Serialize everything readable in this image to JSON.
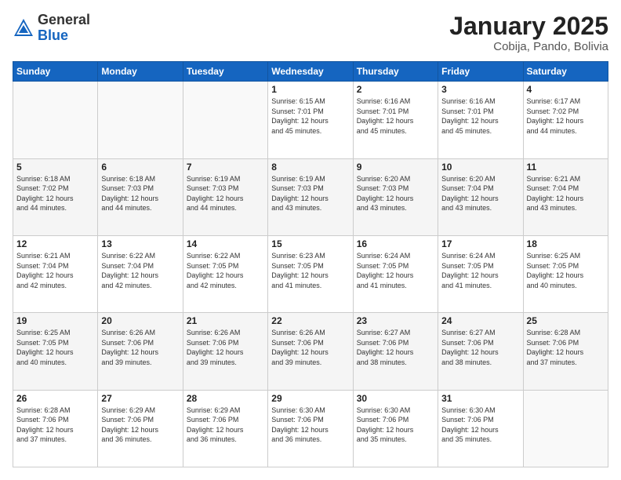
{
  "header": {
    "logo_general": "General",
    "logo_blue": "Blue",
    "month_title": "January 2025",
    "location": "Cobija, Pando, Bolivia"
  },
  "weekdays": [
    "Sunday",
    "Monday",
    "Tuesday",
    "Wednesday",
    "Thursday",
    "Friday",
    "Saturday"
  ],
  "weeks": [
    [
      {
        "day": "",
        "info": ""
      },
      {
        "day": "",
        "info": ""
      },
      {
        "day": "",
        "info": ""
      },
      {
        "day": "1",
        "info": "Sunrise: 6:15 AM\nSunset: 7:01 PM\nDaylight: 12 hours\nand 45 minutes."
      },
      {
        "day": "2",
        "info": "Sunrise: 6:16 AM\nSunset: 7:01 PM\nDaylight: 12 hours\nand 45 minutes."
      },
      {
        "day": "3",
        "info": "Sunrise: 6:16 AM\nSunset: 7:01 PM\nDaylight: 12 hours\nand 45 minutes."
      },
      {
        "day": "4",
        "info": "Sunrise: 6:17 AM\nSunset: 7:02 PM\nDaylight: 12 hours\nand 44 minutes."
      }
    ],
    [
      {
        "day": "5",
        "info": "Sunrise: 6:18 AM\nSunset: 7:02 PM\nDaylight: 12 hours\nand 44 minutes."
      },
      {
        "day": "6",
        "info": "Sunrise: 6:18 AM\nSunset: 7:03 PM\nDaylight: 12 hours\nand 44 minutes."
      },
      {
        "day": "7",
        "info": "Sunrise: 6:19 AM\nSunset: 7:03 PM\nDaylight: 12 hours\nand 44 minutes."
      },
      {
        "day": "8",
        "info": "Sunrise: 6:19 AM\nSunset: 7:03 PM\nDaylight: 12 hours\nand 43 minutes."
      },
      {
        "day": "9",
        "info": "Sunrise: 6:20 AM\nSunset: 7:03 PM\nDaylight: 12 hours\nand 43 minutes."
      },
      {
        "day": "10",
        "info": "Sunrise: 6:20 AM\nSunset: 7:04 PM\nDaylight: 12 hours\nand 43 minutes."
      },
      {
        "day": "11",
        "info": "Sunrise: 6:21 AM\nSunset: 7:04 PM\nDaylight: 12 hours\nand 43 minutes."
      }
    ],
    [
      {
        "day": "12",
        "info": "Sunrise: 6:21 AM\nSunset: 7:04 PM\nDaylight: 12 hours\nand 42 minutes."
      },
      {
        "day": "13",
        "info": "Sunrise: 6:22 AM\nSunset: 7:04 PM\nDaylight: 12 hours\nand 42 minutes."
      },
      {
        "day": "14",
        "info": "Sunrise: 6:22 AM\nSunset: 7:05 PM\nDaylight: 12 hours\nand 42 minutes."
      },
      {
        "day": "15",
        "info": "Sunrise: 6:23 AM\nSunset: 7:05 PM\nDaylight: 12 hours\nand 41 minutes."
      },
      {
        "day": "16",
        "info": "Sunrise: 6:24 AM\nSunset: 7:05 PM\nDaylight: 12 hours\nand 41 minutes."
      },
      {
        "day": "17",
        "info": "Sunrise: 6:24 AM\nSunset: 7:05 PM\nDaylight: 12 hours\nand 41 minutes."
      },
      {
        "day": "18",
        "info": "Sunrise: 6:25 AM\nSunset: 7:05 PM\nDaylight: 12 hours\nand 40 minutes."
      }
    ],
    [
      {
        "day": "19",
        "info": "Sunrise: 6:25 AM\nSunset: 7:05 PM\nDaylight: 12 hours\nand 40 minutes."
      },
      {
        "day": "20",
        "info": "Sunrise: 6:26 AM\nSunset: 7:06 PM\nDaylight: 12 hours\nand 39 minutes."
      },
      {
        "day": "21",
        "info": "Sunrise: 6:26 AM\nSunset: 7:06 PM\nDaylight: 12 hours\nand 39 minutes."
      },
      {
        "day": "22",
        "info": "Sunrise: 6:26 AM\nSunset: 7:06 PM\nDaylight: 12 hours\nand 39 minutes."
      },
      {
        "day": "23",
        "info": "Sunrise: 6:27 AM\nSunset: 7:06 PM\nDaylight: 12 hours\nand 38 minutes."
      },
      {
        "day": "24",
        "info": "Sunrise: 6:27 AM\nSunset: 7:06 PM\nDaylight: 12 hours\nand 38 minutes."
      },
      {
        "day": "25",
        "info": "Sunrise: 6:28 AM\nSunset: 7:06 PM\nDaylight: 12 hours\nand 37 minutes."
      }
    ],
    [
      {
        "day": "26",
        "info": "Sunrise: 6:28 AM\nSunset: 7:06 PM\nDaylight: 12 hours\nand 37 minutes."
      },
      {
        "day": "27",
        "info": "Sunrise: 6:29 AM\nSunset: 7:06 PM\nDaylight: 12 hours\nand 36 minutes."
      },
      {
        "day": "28",
        "info": "Sunrise: 6:29 AM\nSunset: 7:06 PM\nDaylight: 12 hours\nand 36 minutes."
      },
      {
        "day": "29",
        "info": "Sunrise: 6:30 AM\nSunset: 7:06 PM\nDaylight: 12 hours\nand 36 minutes."
      },
      {
        "day": "30",
        "info": "Sunrise: 6:30 AM\nSunset: 7:06 PM\nDaylight: 12 hours\nand 35 minutes."
      },
      {
        "day": "31",
        "info": "Sunrise: 6:30 AM\nSunset: 7:06 PM\nDaylight: 12 hours\nand 35 minutes."
      },
      {
        "day": "",
        "info": ""
      }
    ]
  ]
}
